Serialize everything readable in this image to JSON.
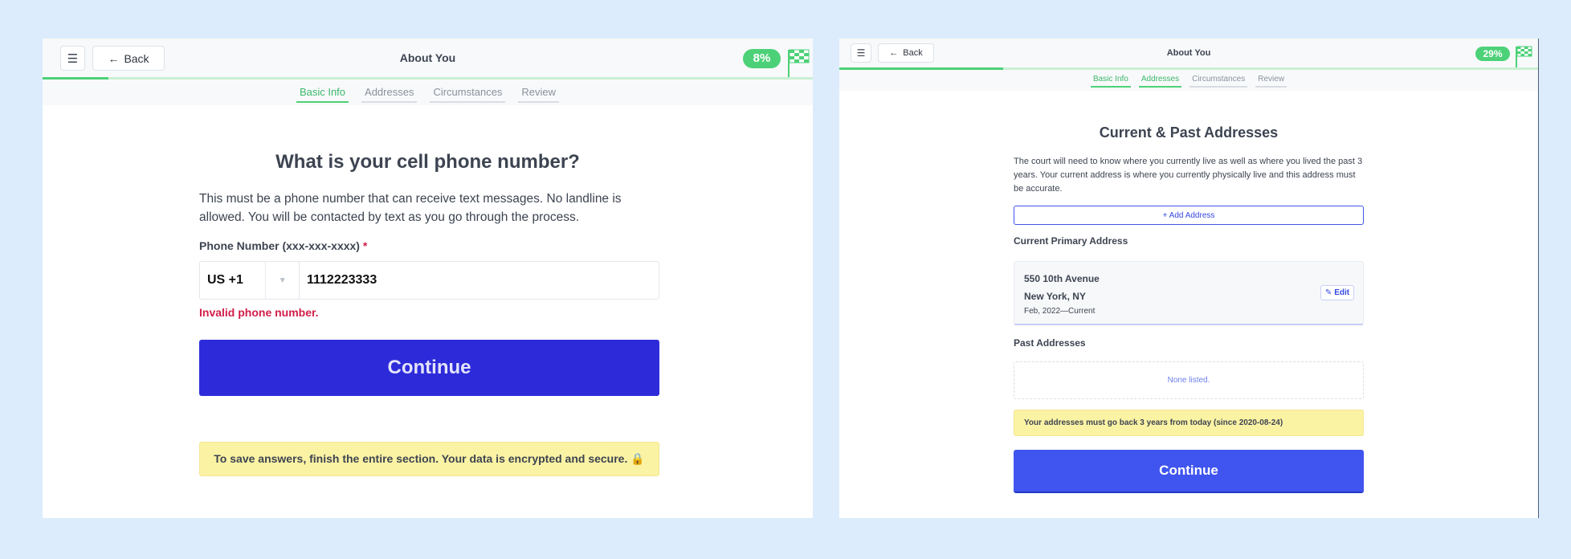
{
  "left": {
    "header": {
      "back_label": "Back",
      "title": "About You",
      "percent": "8%",
      "progress": 0.085
    },
    "tabs": [
      {
        "label": "Basic Info",
        "active": true
      },
      {
        "label": "Addresses",
        "active": false
      },
      {
        "label": "Circumstances",
        "active": false
      },
      {
        "label": "Review",
        "active": false
      }
    ],
    "question": "What is your cell phone number?",
    "description": "This must be a phone number that can receive text messages. No landline is allowed. You will be contacted by text as you go through the process.",
    "field_label": "Phone Number (xxx-xxx-xxxx)",
    "required_mark": "*",
    "country_code": "US +1",
    "phone_value": "1112223333",
    "error": "Invalid phone number.",
    "continue_label": "Continue",
    "notice": "To save answers, finish the entire section. Your data is encrypted and secure. 🔒"
  },
  "right": {
    "header": {
      "back_label": "Back",
      "title": "About You",
      "percent": "29%",
      "progress": 0.235
    },
    "tabs": [
      {
        "label": "Basic Info",
        "active": true
      },
      {
        "label": "Addresses",
        "active": true
      },
      {
        "label": "Circumstances",
        "active": false
      },
      {
        "label": "Review",
        "active": false
      }
    ],
    "heading": "Current & Past Addresses",
    "description": "The court will need to know where you currently live as well as where you lived the past 3 years. Your current address is where you currently physically live and this address must be accurate.",
    "add_label": "+ Add Address",
    "current_label": "Current Primary Address",
    "current_address": {
      "line1": "550 10th Avenue",
      "line2": "New York, NY",
      "dates": "Feb, 2022—Current",
      "edit_label": "Edit"
    },
    "past_label": "Past Addresses",
    "past_empty": "None listed.",
    "notice": "Your addresses must go back 3 years from today (since 2020-08-24)",
    "continue_label": "Continue"
  },
  "colors": {
    "page_bg": "#dcecfc",
    "accent_green": "#4dd178",
    "continue_left": "#2d2bd9",
    "continue_right": "#4054f0",
    "error_red": "#d21e4a",
    "notice_yellow": "#fbf3a4"
  },
  "icons": {
    "menu": "menu-icon",
    "back": "arrow-left-icon",
    "flag": "checkered-flag-icon",
    "caret": "chevron-down-icon",
    "edit": "pencil-icon"
  }
}
